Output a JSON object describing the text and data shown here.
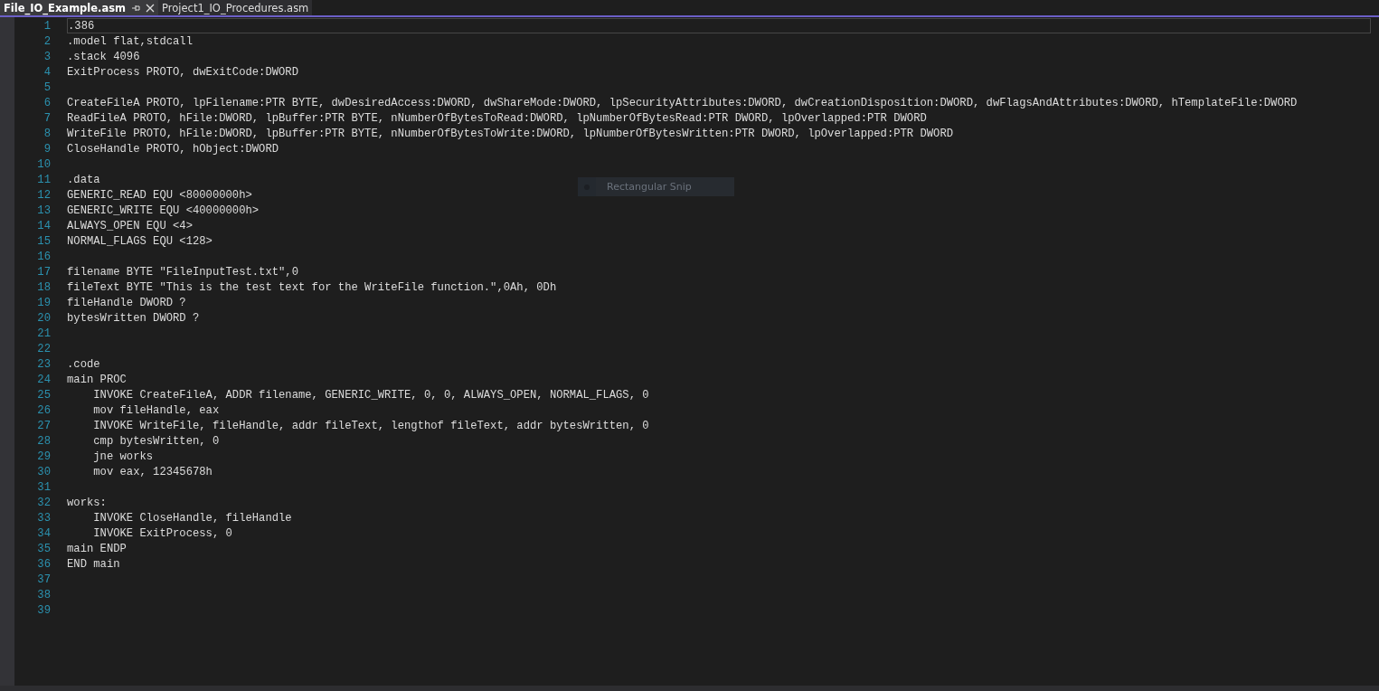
{
  "tabs": [
    {
      "label": "File_IO_Example.asm",
      "selected": true,
      "pinnable": true
    },
    {
      "label": "Project1_IO_Procedures.asm",
      "selected": false,
      "pinnable": false
    }
  ],
  "lines": [
    {
      "number": "1",
      "text": ".386",
      "current": true
    },
    {
      "number": "2",
      "text": ".model flat,stdcall",
      "current": false
    },
    {
      "number": "3",
      "text": ".stack 4096",
      "current": false
    },
    {
      "number": "4",
      "text": "ExitProcess PROTO, dwExitCode:DWORD",
      "current": false
    },
    {
      "number": "5",
      "current": false
    },
    {
      "number": "6",
      "text": "CreateFileA PROTO, lpFilename:PTR BYTE, dwDesiredAccess:DWORD, dwShareMode:DWORD, lpSecurityAttributes:DWORD, dwCreationDisposition:DWORD, dwFlagsAndAttributes:DWORD, hTemplateFile:DWORD",
      "current": false
    },
    {
      "number": "7",
      "text": "ReadFileA PROTO, hFile:DWORD, lpBuffer:PTR BYTE, nNumberOfBytesToRead:DWORD, lpNumberOfBytesRead:PTR DWORD, lpOverlapped:PTR DWORD",
      "current": false
    },
    {
      "number": "8",
      "text": "WriteFile PROTO, hFile:DWORD, lpBuffer:PTR BYTE, nNumberOfBytesToWrite:DWORD, lpNumberOfBytesWritten:PTR DWORD, lpOverlapped:PTR DWORD",
      "current": false
    },
    {
      "number": "9",
      "text": "CloseHandle PROTO, hObject:DWORD",
      "current": false
    },
    {
      "number": "10",
      "current": false
    },
    {
      "number": "11",
      "text": ".data",
      "current": false
    },
    {
      "number": "12",
      "text": "GENERIC_READ EQU <80000000h>",
      "current": false
    },
    {
      "number": "13",
      "text": "GENERIC_WRITE EQU <40000000h>",
      "current": false
    },
    {
      "number": "14",
      "text": "ALWAYS_OPEN EQU <4>",
      "current": false
    },
    {
      "number": "15",
      "text": "NORMAL_FLAGS EQU <128>",
      "current": false
    },
    {
      "number": "16",
      "current": false
    },
    {
      "number": "17",
      "text": "filename BYTE \"FileInputTest.txt\",0",
      "current": false
    },
    {
      "number": "18",
      "text": "fileText BYTE \"This is the test text for the WriteFile function.\",0Ah, 0Dh",
      "current": false
    },
    {
      "number": "19",
      "text": "fileHandle DWORD ?",
      "current": false
    },
    {
      "number": "20",
      "text": "bytesWritten DWORD ?",
      "current": false
    },
    {
      "number": "21",
      "current": false
    },
    {
      "number": "22",
      "current": false
    },
    {
      "number": "23",
      "text": ".code",
      "current": false
    },
    {
      "number": "24",
      "text": "main PROC",
      "current": false
    },
    {
      "number": "25",
      "text": "    INVOKE CreateFileA, ADDR filename, GENERIC_WRITE, 0, 0, ALWAYS_OPEN, NORMAL_FLAGS, 0",
      "current": false
    },
    {
      "number": "26",
      "text": "    mov fileHandle, eax",
      "current": false
    },
    {
      "number": "27",
      "text": "    INVOKE WriteFile, fileHandle, addr fileText, lengthof fileText, addr bytesWritten, 0",
      "current": false
    },
    {
      "number": "28",
      "text": "    cmp bytesWritten, 0",
      "current": false
    },
    {
      "number": "29",
      "text": "    jne works",
      "current": false
    },
    {
      "number": "30",
      "text": "    mov eax, 12345678h",
      "current": false
    },
    {
      "number": "31",
      "current": false
    },
    {
      "number": "32",
      "text": "works:",
      "current": false
    },
    {
      "number": "33",
      "text": "    INVOKE CloseHandle, fileHandle",
      "current": false
    },
    {
      "number": "34",
      "text": "    INVOKE ExitProcess, 0",
      "current": false
    },
    {
      "number": "35",
      "text": "main ENDP",
      "current": false
    },
    {
      "number": "36",
      "text": "END main",
      "current": false
    },
    {
      "number": "37",
      "current": false
    },
    {
      "number": "38",
      "current": false
    },
    {
      "number": "39",
      "current": false
    }
  ],
  "snip_tooltip": {
    "label": "Rectangular Snip"
  }
}
